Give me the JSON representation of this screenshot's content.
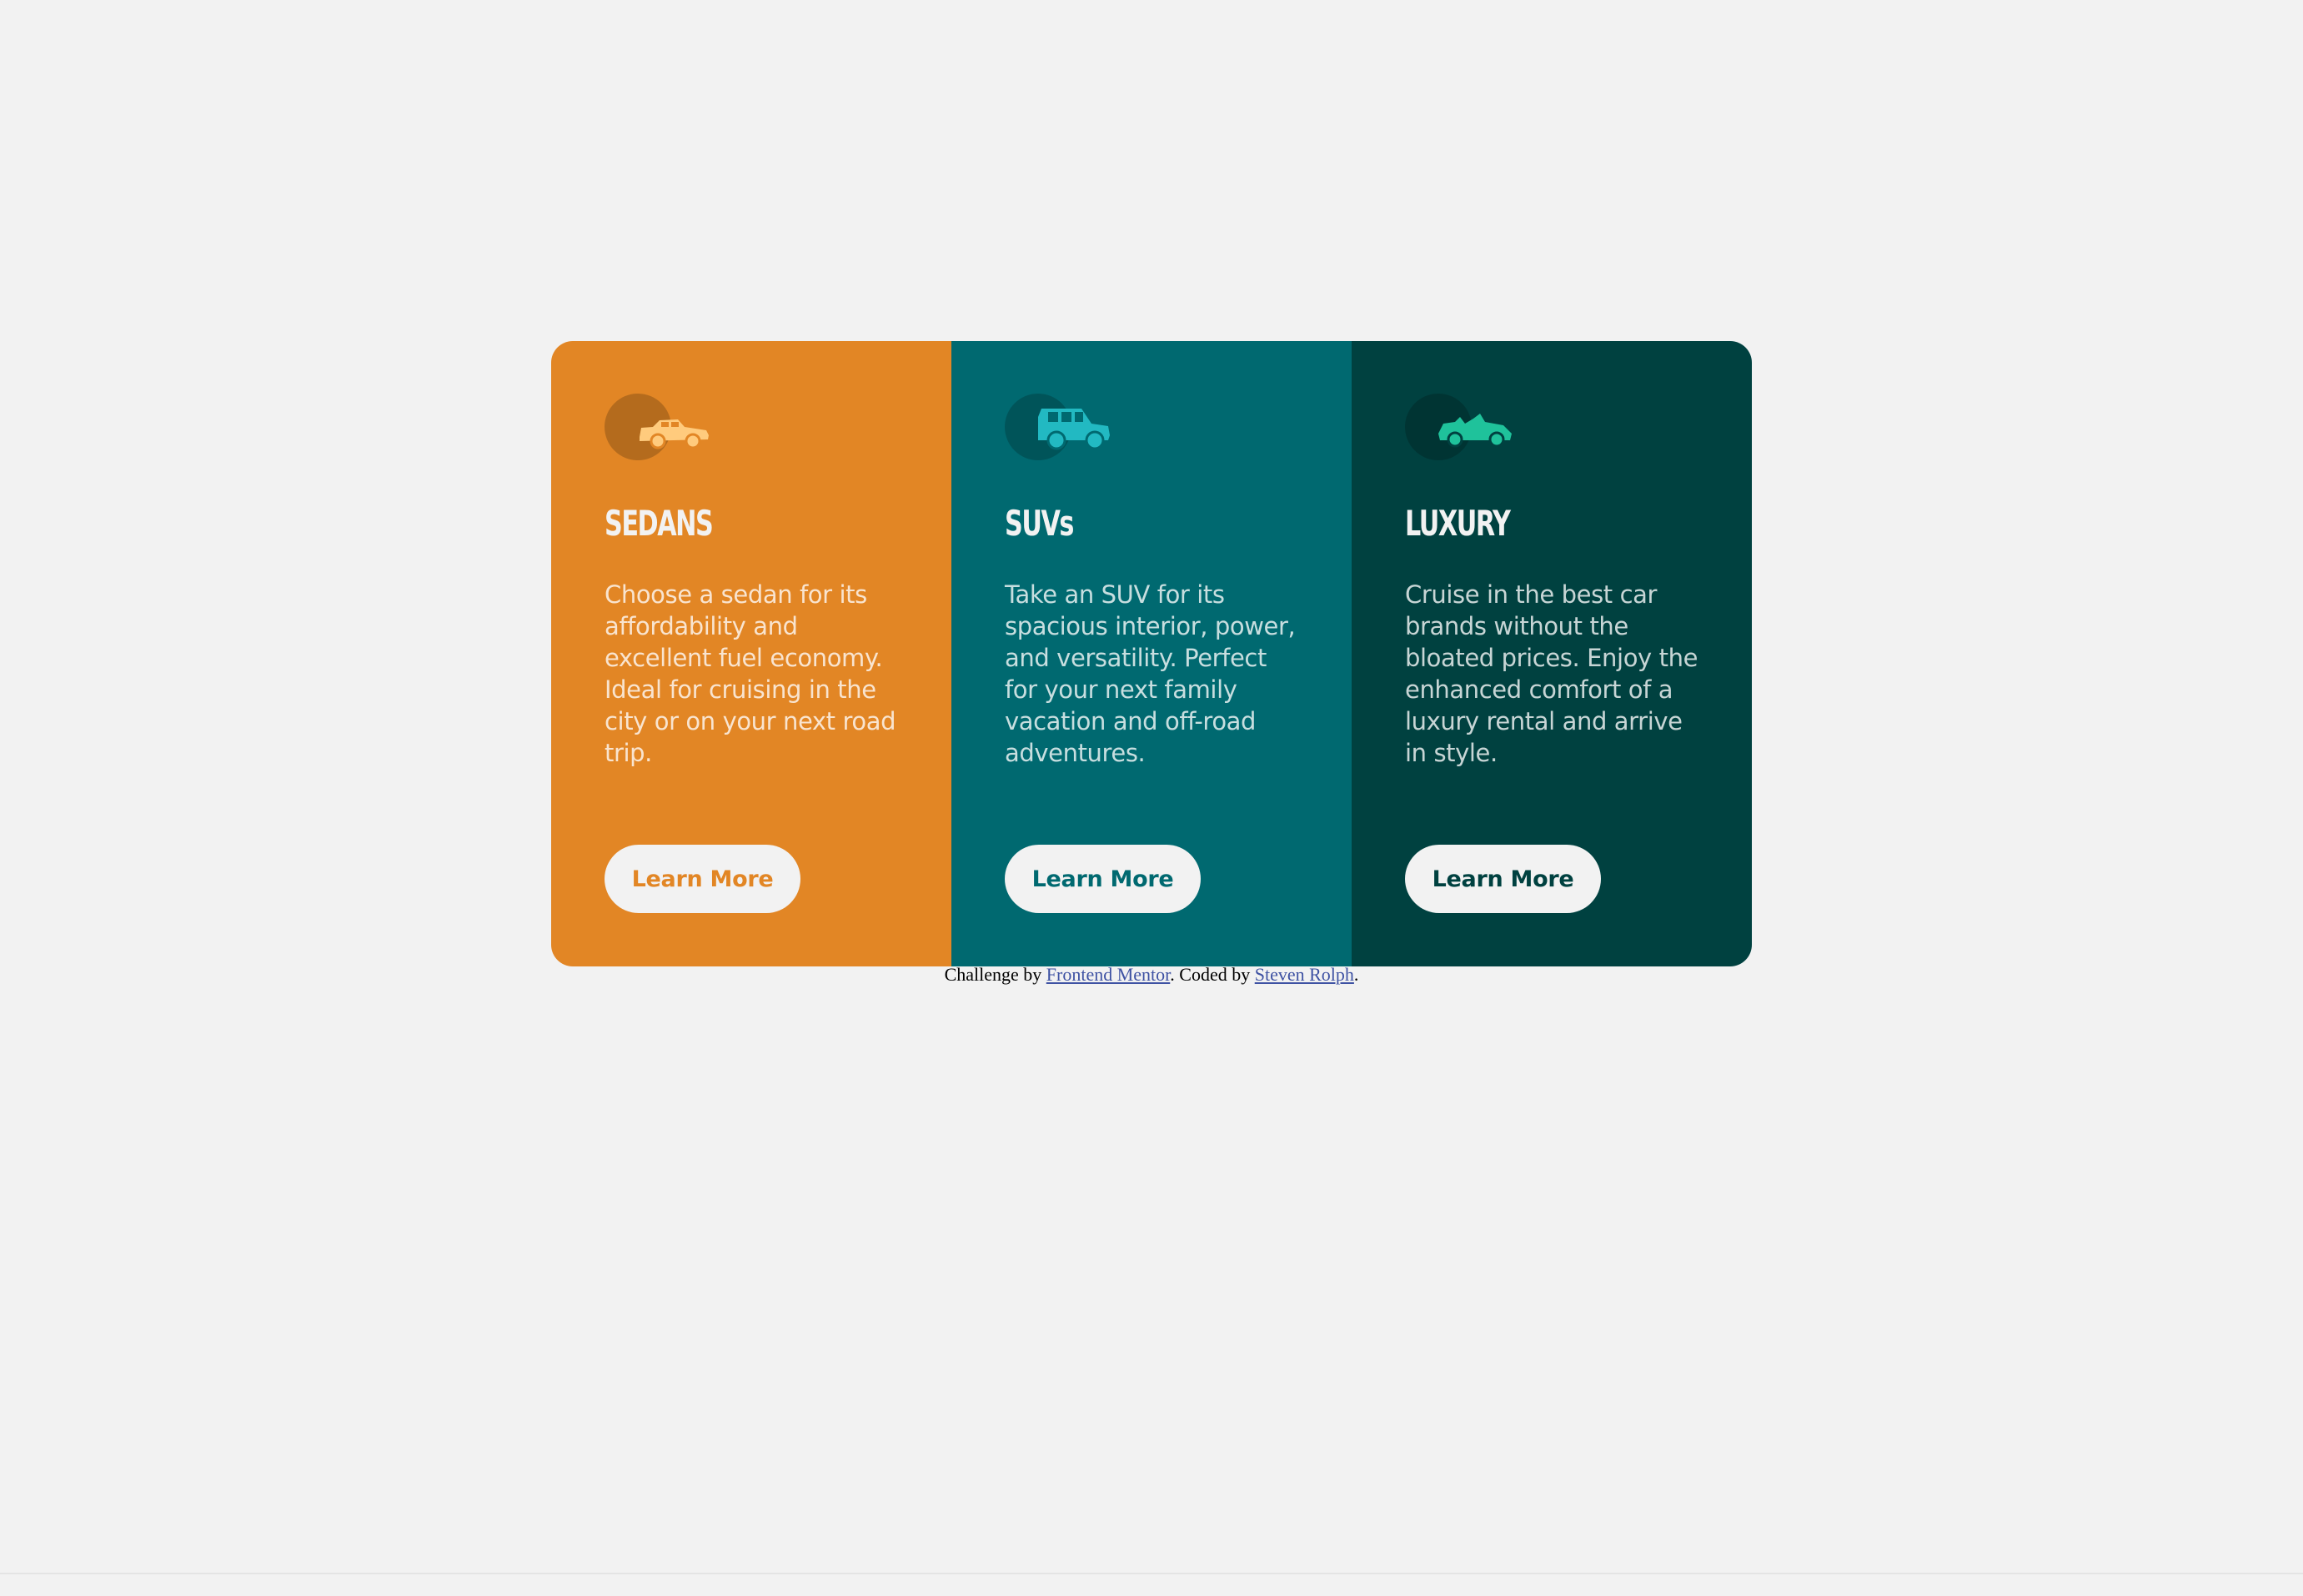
{
  "colors": {
    "page_bg": "#f2f2f2",
    "sedans": "#e28625",
    "suvs": "#006970",
    "luxury": "#004140",
    "sedan_icon": "#ffcb7d",
    "suv_icon": "#22b9c2",
    "luxury_icon": "#1fc29b",
    "link": "#3e52a3"
  },
  "cards": [
    {
      "icon": "sedan-car-icon",
      "title": "SEDANS",
      "text": "Choose a sedan for its affordability and excellent fuel economy. Ideal for cruising in the city or on your next road trip.",
      "button_label": "Learn More"
    },
    {
      "icon": "suv-car-icon",
      "title": "SUVs",
      "text": "Take an SUV for its spacious interior, power, and versatility. Perfect for your next family vacation and off-road adventures.",
      "button_label": "Learn More"
    },
    {
      "icon": "luxury-car-icon",
      "title": "LUXURY",
      "text": "Cruise in the best car brands without the bloated prices. Enjoy the enhanced comfort of a luxury rental and arrive in style.",
      "button_label": "Learn More"
    }
  ],
  "attribution": {
    "prefix": "Challenge by ",
    "link1": "Frontend Mentor",
    "middle": ". Coded by ",
    "link2": "Steven Rolph",
    "suffix": "."
  }
}
